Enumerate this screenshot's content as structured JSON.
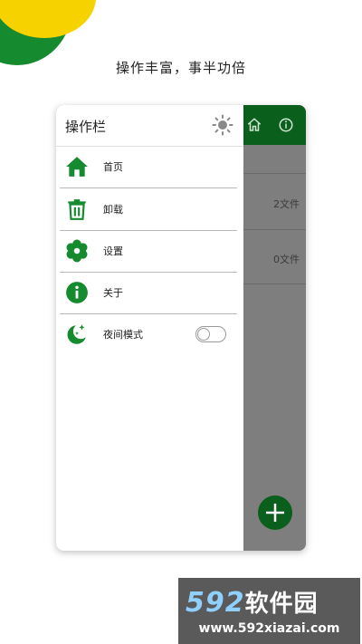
{
  "headline": "操作丰富，事半功倍",
  "drawer": {
    "title": "操作栏",
    "items": [
      {
        "label": "首页",
        "icon": "home-icon"
      },
      {
        "label": "卸载",
        "icon": "trash-icon"
      },
      {
        "label": "设置",
        "icon": "gear-icon"
      },
      {
        "label": "关于",
        "icon": "info-icon"
      },
      {
        "label": "夜间模式",
        "icon": "moon-stars-icon"
      }
    ],
    "night_mode_enabled": false
  },
  "background_app": {
    "rows": [
      {
        "count": "2文件"
      },
      {
        "count": "0文件"
      }
    ]
  },
  "watermark": {
    "brand_digits": "592",
    "brand_text": "软件园",
    "url": "www.592xiazai.com"
  },
  "colors": {
    "accent": "#168a2e",
    "dark_green": "#0a5f1c",
    "yellow": "#f6d300"
  }
}
